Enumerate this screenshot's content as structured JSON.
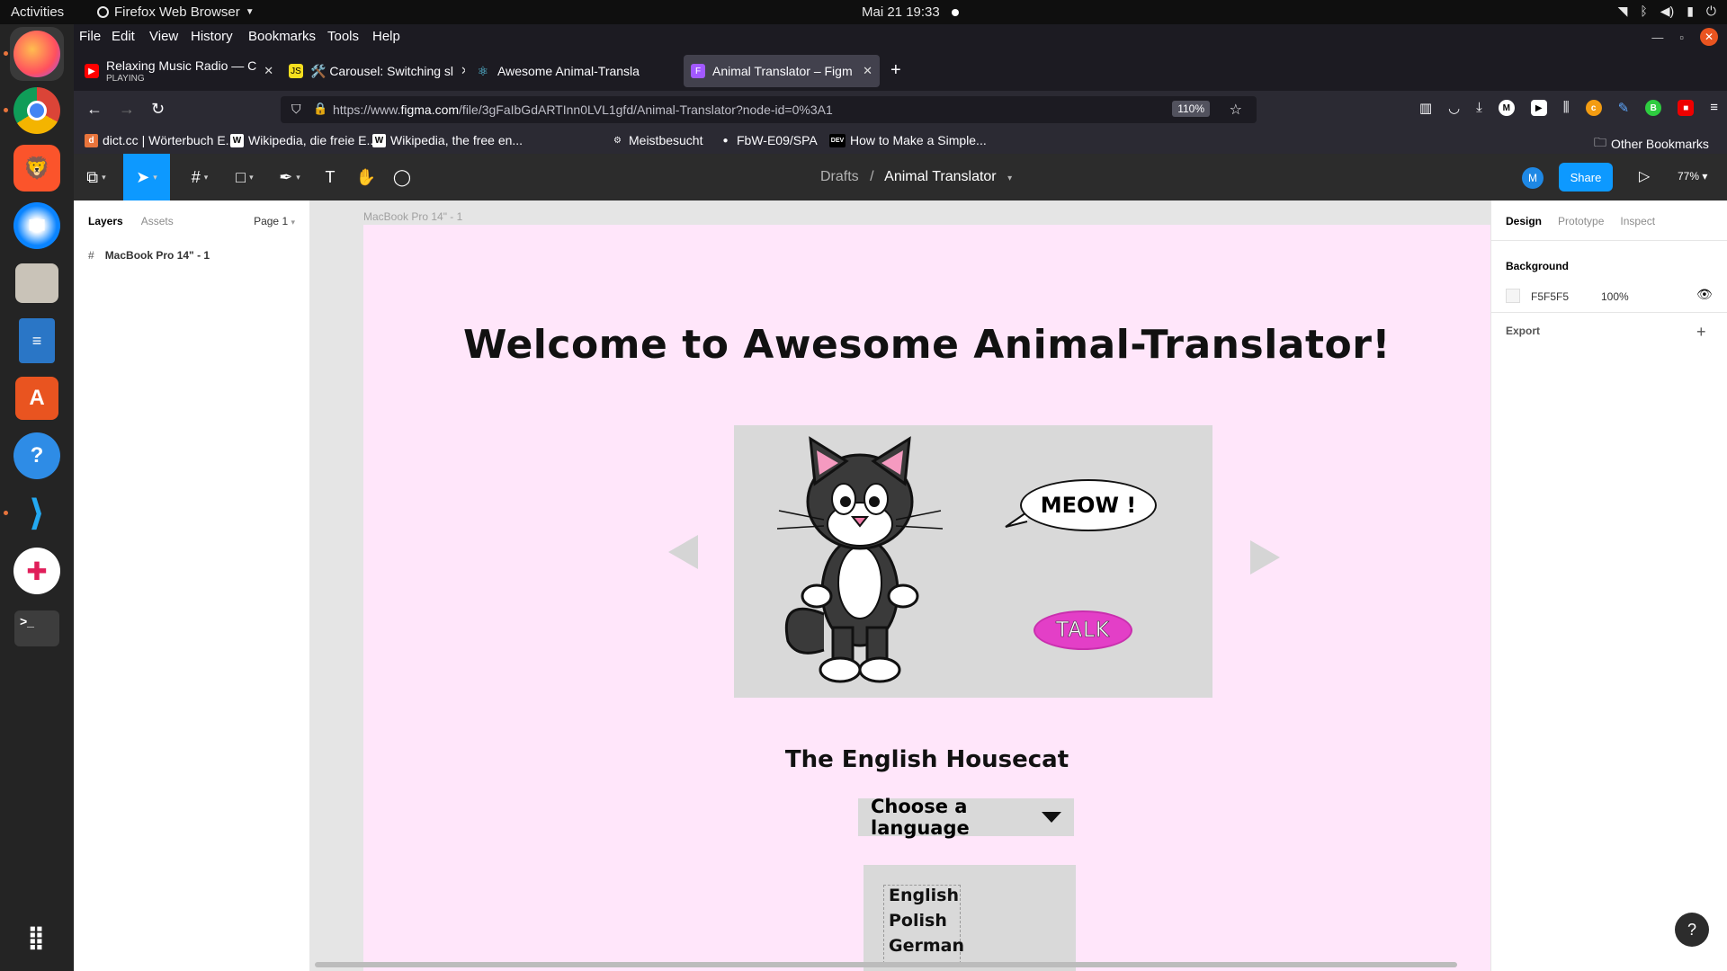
{
  "gnome": {
    "activities": "Activities",
    "app_name": "Firefox Web Browser",
    "clock": "Mai 21  19:33"
  },
  "dock": {
    "items": [
      "firefox-icon",
      "chrome-icon",
      "brave-icon",
      "thunderbird-icon",
      "files-icon",
      "writer-icon",
      "app-center-icon",
      "help-icon",
      "vscode-icon",
      "slack-icon",
      "terminal-icon",
      "app-grid-icon"
    ]
  },
  "menubar": {
    "items": [
      "File",
      "Edit",
      "View",
      "History",
      "Bookmarks",
      "Tools",
      "Help"
    ]
  },
  "tabs": [
    {
      "title": "Relaxing Music Radio — C",
      "sub": "PLAYING",
      "favicon_color": "#ff0000"
    },
    {
      "title": "🛠️ Carousel: Switching sl",
      "favicon_color": "#f7df1e"
    },
    {
      "title": "Awesome Animal-Transla",
      "favicon_color": "#61dafb"
    },
    {
      "title": "Animal Translator – Figm",
      "favicon_color": "#a259ff"
    }
  ],
  "navbar": {
    "url_prefix": "https://www.",
    "url_domain": "figma.com",
    "url_path": "/file/3gFaIbGdARTInn0LVL1gfd/Animal-Translator?node-id=0%3A1",
    "zoom": "110%"
  },
  "bookmarks": [
    {
      "label": "dict.cc | Wörterbuch E...",
      "icon": "d",
      "color": "#e8743c"
    },
    {
      "label": "Wikipedia, die freie E...",
      "icon": "W",
      "color": "#ffffff"
    },
    {
      "label": "Wikipedia, the free en...",
      "icon": "W",
      "color": "#ffffff"
    },
    {
      "label": "Meistbesucht",
      "icon": "⚙",
      "color": "transparent"
    },
    {
      "label": "FbW-E09/SPA",
      "icon": "●",
      "color": "transparent"
    },
    {
      "label": "How to Make a Simple...",
      "icon": "DEV",
      "color": "#000000"
    }
  ],
  "other_bookmarks": "Other Bookmarks",
  "figma": {
    "breadcrumb_root": "Drafts",
    "breadcrumb_sep": "/",
    "file_name": "Animal Translator",
    "avatar_initial": "M",
    "share_label": "Share",
    "zoom": "77%",
    "layers_tab": "Layers",
    "assets_tab": "Assets",
    "page_label": "Page 1",
    "layer_name": "MacBook Pro 14\" - 1",
    "frame_label": "MacBook Pro 14\" - 1",
    "design_tab": "Design",
    "prototype_tab": "Prototype",
    "inspect_tab": "Inspect",
    "background_label": "Background",
    "bg_hex": "F5F5F5",
    "bg_opacity": "100%",
    "export_label": "Export",
    "help": "?"
  },
  "design": {
    "welcome": "Welcome to Awesome Animal-Translator!",
    "bubble": "MEOW !",
    "talk": "TALK",
    "animal_name": "The English Housecat",
    "select_placeholder": "Choose a language",
    "languages": [
      "English",
      "Polish",
      "German"
    ],
    "frame_bg": "#ffe6fa",
    "talk_color": "#e33fc7"
  }
}
